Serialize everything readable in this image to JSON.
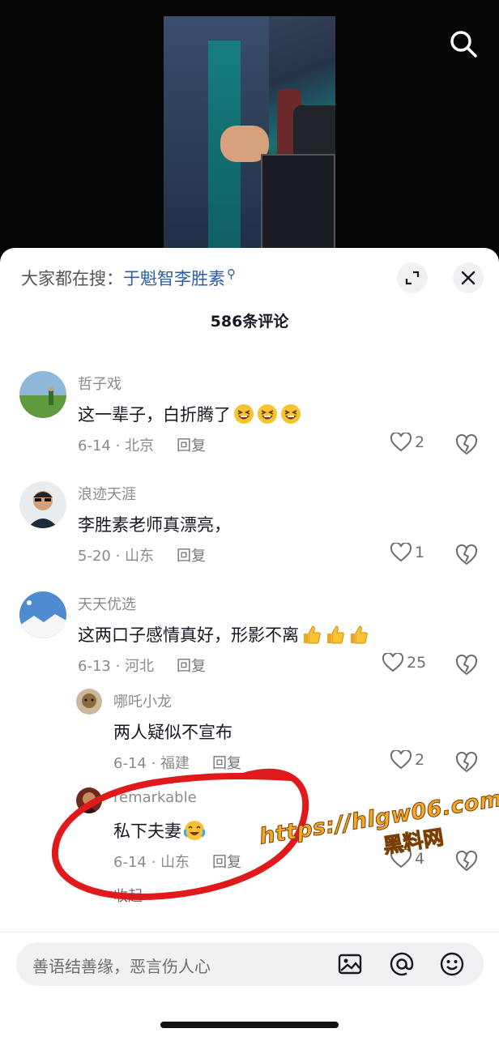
{
  "search_hint": {
    "prefix": "大家都在搜：",
    "keyword": "于魁智李胜素"
  },
  "comment_count": "586条评论",
  "comments": [
    {
      "user": "哲子戏",
      "text": "这一辈子，白折腾了",
      "emoji": "laughing-tears",
      "emoji_count": 3,
      "date_location": "6-14 · 北京",
      "reply": "回复",
      "likes": "2"
    },
    {
      "user": "浪迹天涯",
      "text": "李胜素老师真漂亮，",
      "date_location": "5-20 · 山东",
      "reply": "回复",
      "likes": "1"
    },
    {
      "user": "天天优选",
      "text": "这两口子感情真好，形影不离",
      "emoji": "thumbs-up",
      "emoji_count": 3,
      "date_location": "6-13 · 河北",
      "reply": "回复",
      "likes": "25"
    }
  ],
  "replies": [
    {
      "user": "哪吒小龙",
      "text": "两人疑似不宣布",
      "date_location": "6-14 · 福建",
      "reply": "回复",
      "likes": "2"
    },
    {
      "user": "remarkable",
      "text": "私下夫妻",
      "emoji": "crying-laughing",
      "date_location": "6-14 · 山东",
      "reply": "回复",
      "likes": "4"
    }
  ],
  "collapse_label": "收起",
  "watermark": {
    "url": "https://hlgw06.com",
    "name": "黑料网"
  },
  "input": {
    "placeholder": "善语结善缘，恶言伤人心"
  },
  "icons": [
    "search-icon",
    "expand-icon",
    "close-icon",
    "heart-icon",
    "broken-heart-icon",
    "image-icon",
    "at-icon",
    "emoji-icon"
  ],
  "colors": {
    "keyword": "#2b5fa8",
    "scribble": "#e0191b",
    "watermark": "#f2a92a"
  }
}
